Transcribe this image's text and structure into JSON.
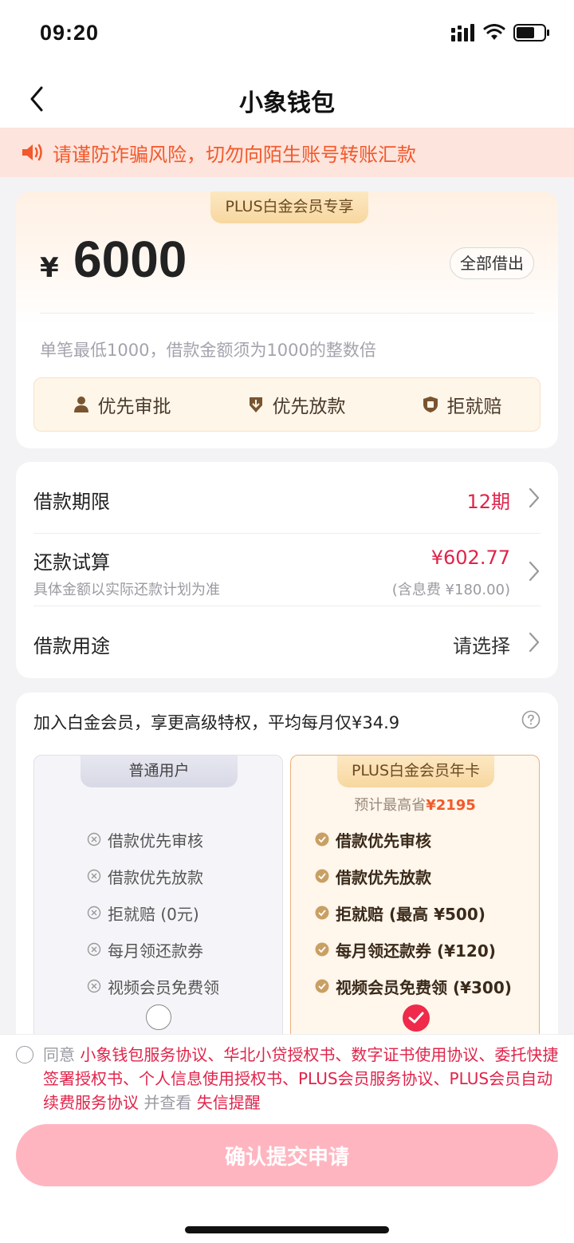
{
  "status_bar": {
    "time": "09:20"
  },
  "nav": {
    "title": "小象钱包"
  },
  "warning": {
    "text": "请谨防诈骗风险，切勿向陌生账号转账汇款"
  },
  "amount_card": {
    "tag": "PLUS白金会员专享",
    "currency": "¥",
    "amount": "6000",
    "all_button": "全部借出",
    "hint": "单笔最低1000，借款金额须为1000的整数倍",
    "benefits": [
      "优先审批",
      "优先放款",
      "拒就赔"
    ]
  },
  "loan": {
    "term_label": "借款期限",
    "term_value": "12期",
    "repay_label": "还款试算",
    "repay_sub": "具体金额以实际还款计划为准",
    "repay_value": "¥602.77",
    "repay_value_sub": "(含息费 ¥180.00)",
    "purpose_label": "借款用途",
    "purpose_value": "请选择"
  },
  "membership": {
    "title": "加入白金会员，享更高级特权，平均每月仅¥34.9",
    "normal": {
      "tag": "普通用户",
      "features": [
        "借款优先审核",
        "借款优先放款",
        "拒就赔 (0元)",
        "每月领还款券",
        "视频会员免费领"
      ]
    },
    "plus": {
      "tag": "PLUS白金会员年卡",
      "save_prefix": "预计最高省",
      "save_value": "¥2195",
      "features": [
        "借款优先审核",
        "借款优先放款",
        "拒就赔 (最高 ¥500)",
        "每月领还款券 (¥120)",
        "视频会员免费领 (¥300)"
      ]
    }
  },
  "agreement": {
    "prefix": "同意",
    "docs": "小象钱包服务协议、华北小贷授权书、数字证书使用协议、委托快捷签署授权书、个人信息使用授权书、PLUS会员服务协议、PLUS会员自动续费服务协议",
    "mid": "并查看",
    "last": "失信提醒"
  },
  "submit": {
    "label": "确认提交申请"
  },
  "colors": {
    "accent": "#ef2a4a",
    "warning": "#f2592c",
    "gold": "#c9a063"
  }
}
